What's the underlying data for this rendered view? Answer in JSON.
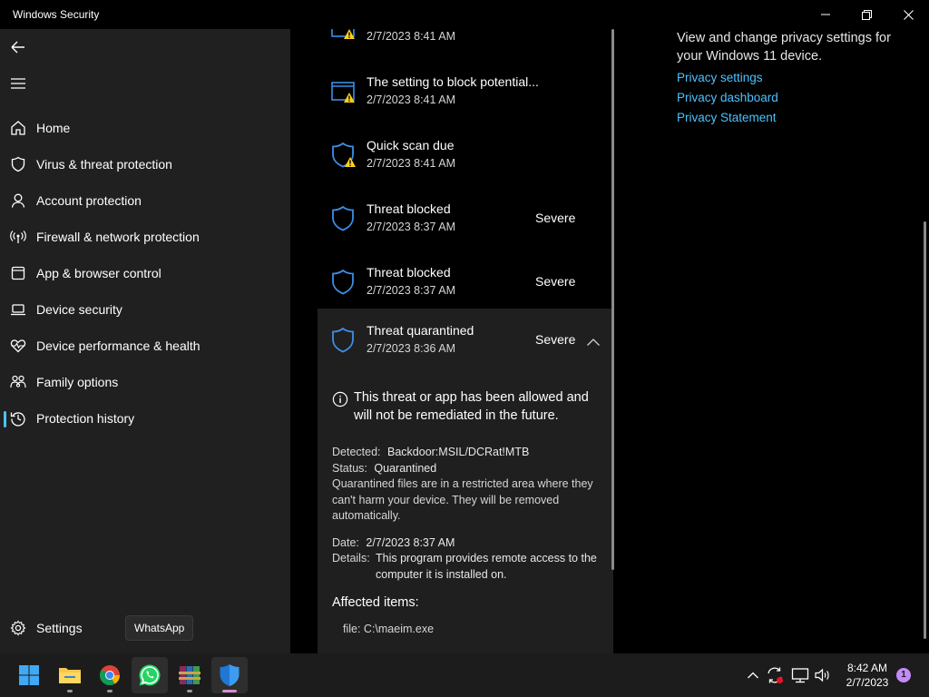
{
  "window": {
    "title": "Windows Security"
  },
  "sidebar": {
    "items": [
      {
        "label": "Home",
        "icon": "home-icon"
      },
      {
        "label": "Virus & threat protection",
        "icon": "shield-icon"
      },
      {
        "label": "Account protection",
        "icon": "person-icon"
      },
      {
        "label": "Firewall & network protection",
        "icon": "wifi-icon"
      },
      {
        "label": "App & browser control",
        "icon": "app-window-icon"
      },
      {
        "label": "Device security",
        "icon": "laptop-icon"
      },
      {
        "label": "Device performance & health",
        "icon": "heart-pulse-icon"
      },
      {
        "label": "Family options",
        "icon": "family-icon"
      },
      {
        "label": "Protection history",
        "icon": "history-icon",
        "selected": true
      }
    ],
    "settings_label": "Settings",
    "tooltip": "WhatsApp"
  },
  "history": {
    "items": [
      {
        "title": "",
        "date": "2/7/2023 8:41 AM",
        "severity": "",
        "icon": "warning-window-icon"
      },
      {
        "title": "The setting to block potential...",
        "date": "2/7/2023 8:41 AM",
        "severity": "",
        "icon": "warning-window-icon"
      },
      {
        "title": "Quick scan due",
        "date": "2/7/2023 8:41 AM",
        "severity": "",
        "icon": "warning-shield-icon"
      },
      {
        "title": "Threat blocked",
        "date": "2/7/2023 8:37 AM",
        "severity": "Severe",
        "icon": "shield-icon"
      },
      {
        "title": "Threat blocked",
        "date": "2/7/2023 8:37 AM",
        "severity": "Severe",
        "icon": "shield-icon"
      }
    ],
    "expanded": {
      "title": "Threat quarantined",
      "date": "2/7/2023 8:36 AM",
      "severity": "Severe",
      "info": "This threat or app has been allowed and will not be remediated in the future.",
      "detected_label": "Detected:",
      "detected_value": "Backdoor:MSIL/DCRat!MTB",
      "status_label": "Status:",
      "status_value": "Quarantined",
      "status_desc": "Quarantined files are in a restricted area where they can't harm your device. They will be removed automatically.",
      "date_label": "Date:",
      "date_value": "2/7/2023 8:37 AM",
      "details_label": "Details:",
      "details_value": "This program provides remote access to the computer it is installed on.",
      "affected_heading": "Affected items:",
      "affected_file": "file: C:\\maeim.exe"
    }
  },
  "privacy": {
    "description": "View and change privacy settings for your Windows 11 device.",
    "links": [
      "Privacy settings",
      "Privacy dashboard",
      "Privacy Statement"
    ]
  },
  "taskbar": {
    "apps": [
      "start-icon",
      "file-explorer-icon",
      "chrome-icon",
      "whatsapp-icon",
      "winrar-icon",
      "windows-security-icon"
    ],
    "time": "8:42 AM",
    "date": "2/7/2023",
    "notification_count": "1"
  },
  "colors": {
    "accent": "#4cc2ff",
    "sidebar_bg": "#202020",
    "warning": "#fcd116",
    "shield_blue": "#3d8ee6"
  }
}
